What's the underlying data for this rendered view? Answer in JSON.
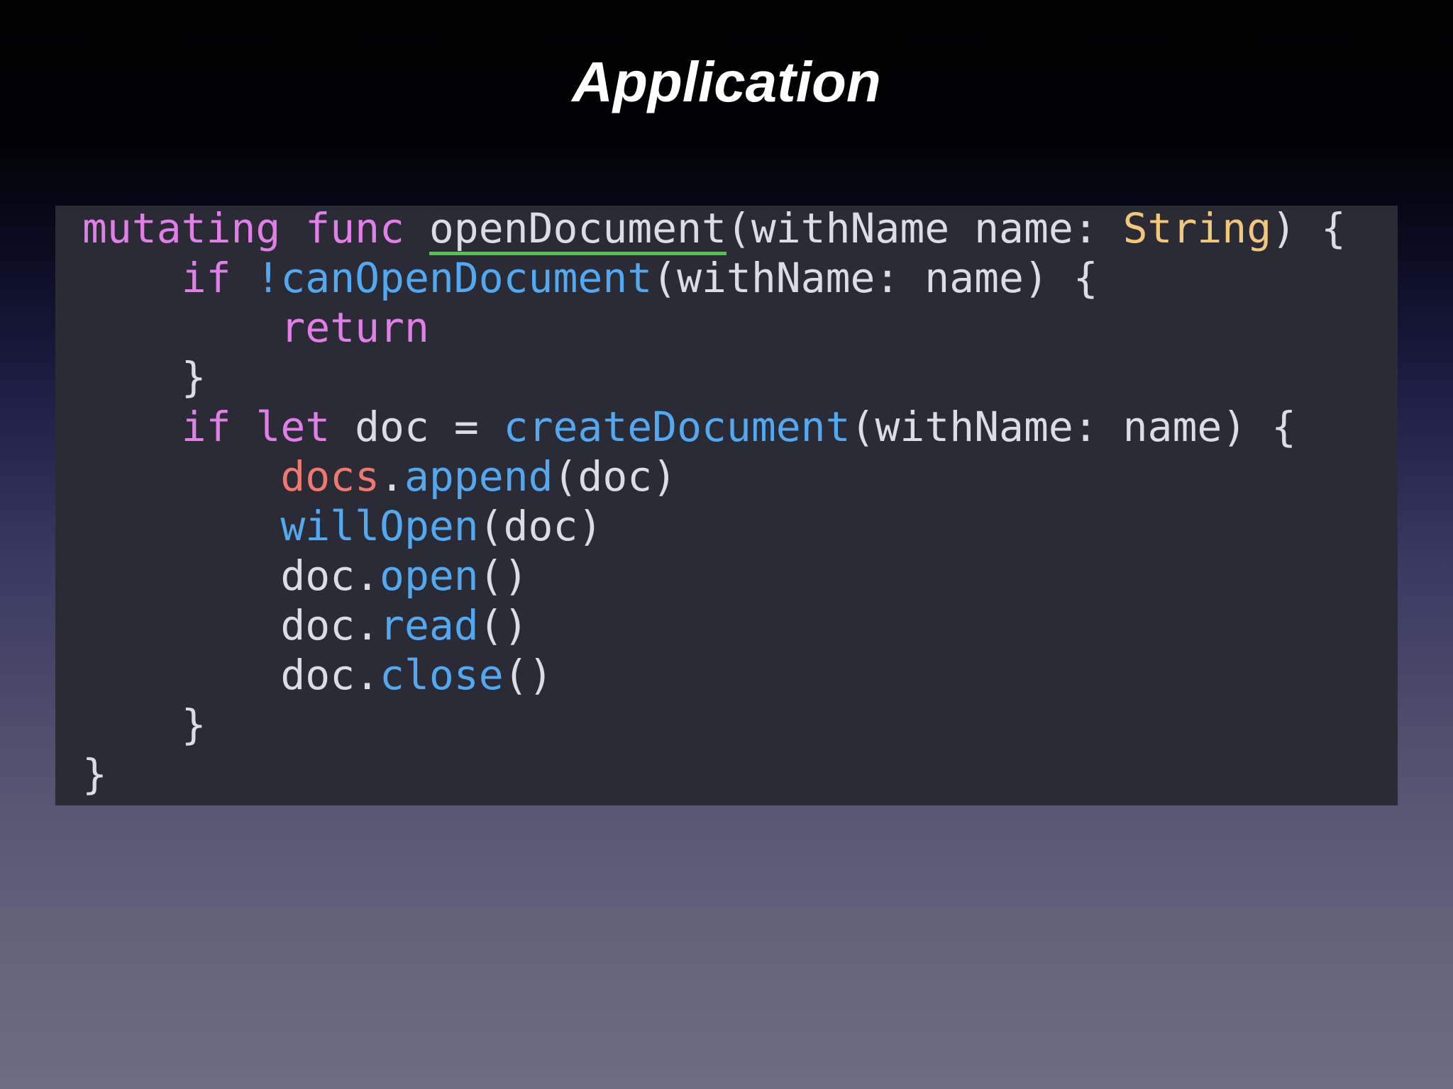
{
  "slide": {
    "title": "Application"
  },
  "code": {
    "line1": {
      "kw1": "mutating",
      "sp1": " ",
      "kw2": "func",
      "sp2": " ",
      "fn": "openDocument",
      "rest1": "(withName name: ",
      "type": "String",
      "rest2": ") {"
    },
    "line2": {
      "indent": "    ",
      "kw": "if",
      "sp": " ",
      "fn": "!canOpenDocument",
      "rest": "(withName: name) {"
    },
    "line3": {
      "indent": "        ",
      "kw": "return"
    },
    "line4": {
      "text": "    }"
    },
    "line5": {
      "indent": "    ",
      "kw1": "if",
      "sp1": " ",
      "kw2": "let",
      "rest1": " doc = ",
      "fn": "createDocument",
      "rest2": "(withName: name) {"
    },
    "line6": {
      "indent": "        ",
      "var": "docs",
      "dot": ".",
      "fn": "append",
      "rest": "(doc)"
    },
    "line7": {
      "indent": "        ",
      "fn": "willOpen",
      "rest": "(doc)"
    },
    "line8": {
      "indent": "        ",
      "obj": "doc.",
      "fn": "open",
      "rest": "()"
    },
    "line9": {
      "indent": "        ",
      "obj": "doc.",
      "fn": "read",
      "rest": "()"
    },
    "line10": {
      "indent": "        ",
      "obj": "doc.",
      "fn": "close",
      "rest": "()"
    },
    "line11": {
      "text": "    }"
    },
    "line12": {
      "text": "}"
    }
  },
  "colors": {
    "keyword": "#e17ee8",
    "function": "#52a9f2",
    "type": "#f2c77a",
    "variable": "#f0786f",
    "plain": "#dcdce4",
    "panel": "#2b2b36",
    "underline": "#4fc742"
  }
}
